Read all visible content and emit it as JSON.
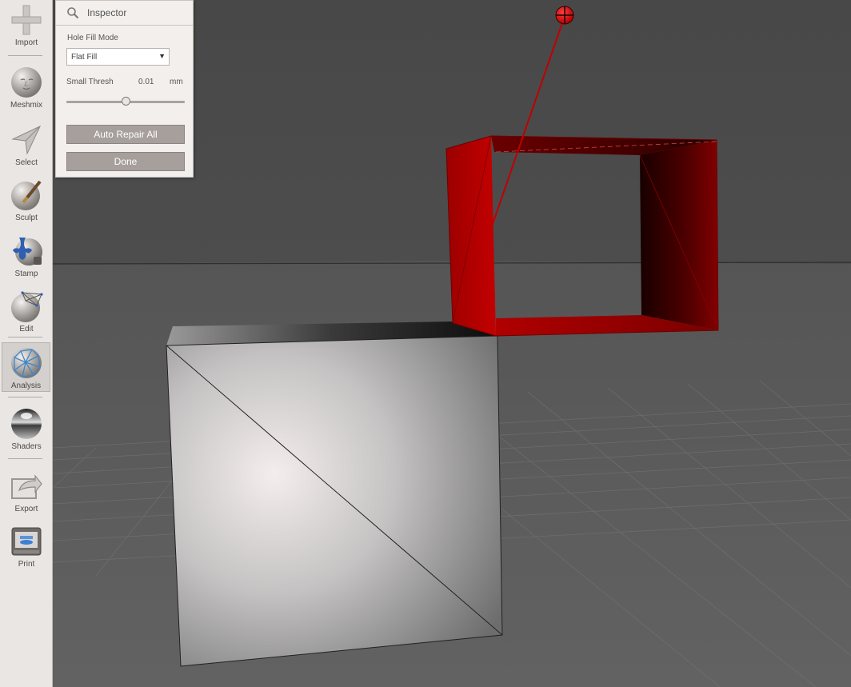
{
  "toolbar": {
    "items": [
      {
        "label": "Import",
        "icon": "plus-icon"
      },
      {
        "label": "Meshmix",
        "icon": "face-sphere-icon"
      },
      {
        "label": "Select",
        "icon": "arrow-cursor-icon"
      },
      {
        "label": "Sculpt",
        "icon": "brush-sphere-icon"
      },
      {
        "label": "Stamp",
        "icon": "fleur-sphere-icon"
      },
      {
        "label": "Edit",
        "icon": "mesh-sphere-icon"
      },
      {
        "label": "Analysis",
        "icon": "network-sphere-icon",
        "active": true
      },
      {
        "label": "Shaders",
        "icon": "chrome-sphere-icon"
      },
      {
        "label": "Export",
        "icon": "export-arrow-icon"
      },
      {
        "label": "Print",
        "icon": "printer-icon"
      }
    ]
  },
  "inspector": {
    "title": "Inspector",
    "hole_fill_mode_label": "Hole Fill Mode",
    "hole_fill_mode_value": "Flat Fill",
    "small_thresh_label": "Small Thresh",
    "small_thresh_value": "0.01",
    "small_thresh_unit": "mm",
    "small_thresh_slider_fraction": 0.5,
    "auto_repair_label": "Auto Repair All",
    "done_label": "Done"
  },
  "viewport": {
    "background_color": "#4a4a4a",
    "floor_color": "#5b5b5b",
    "highlight_color": "#c00000",
    "objects": [
      "solid-cube",
      "open-red-box",
      "hole-marker"
    ]
  }
}
